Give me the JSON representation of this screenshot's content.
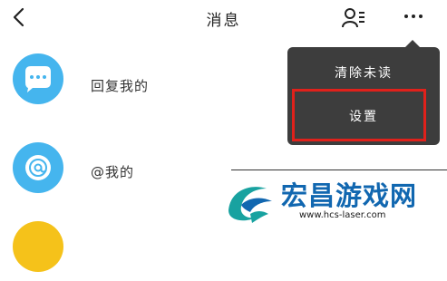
{
  "header": {
    "title": "消息",
    "back_icon": "chevron-left-icon",
    "contacts_icon": "contacts-icon",
    "more_icon": "more-dots-icon"
  },
  "list": [
    {
      "label": "回复我的",
      "icon": "chat-bubble-icon",
      "color": "#45b5ee"
    },
    {
      "label": "@我的",
      "icon": "at-sign-icon",
      "color": "#45b5ee"
    },
    {
      "label": "",
      "icon": "",
      "color": "#f5c21a"
    }
  ],
  "menu": {
    "items": [
      {
        "label": "清除未读"
      },
      {
        "label": "设置"
      }
    ],
    "background": "#3d3d3d",
    "highlight_color": "#e0211b"
  },
  "watermark": {
    "text": "宏昌游戏网",
    "url": "www.hcs-laser.com",
    "color": "#1167b0"
  }
}
